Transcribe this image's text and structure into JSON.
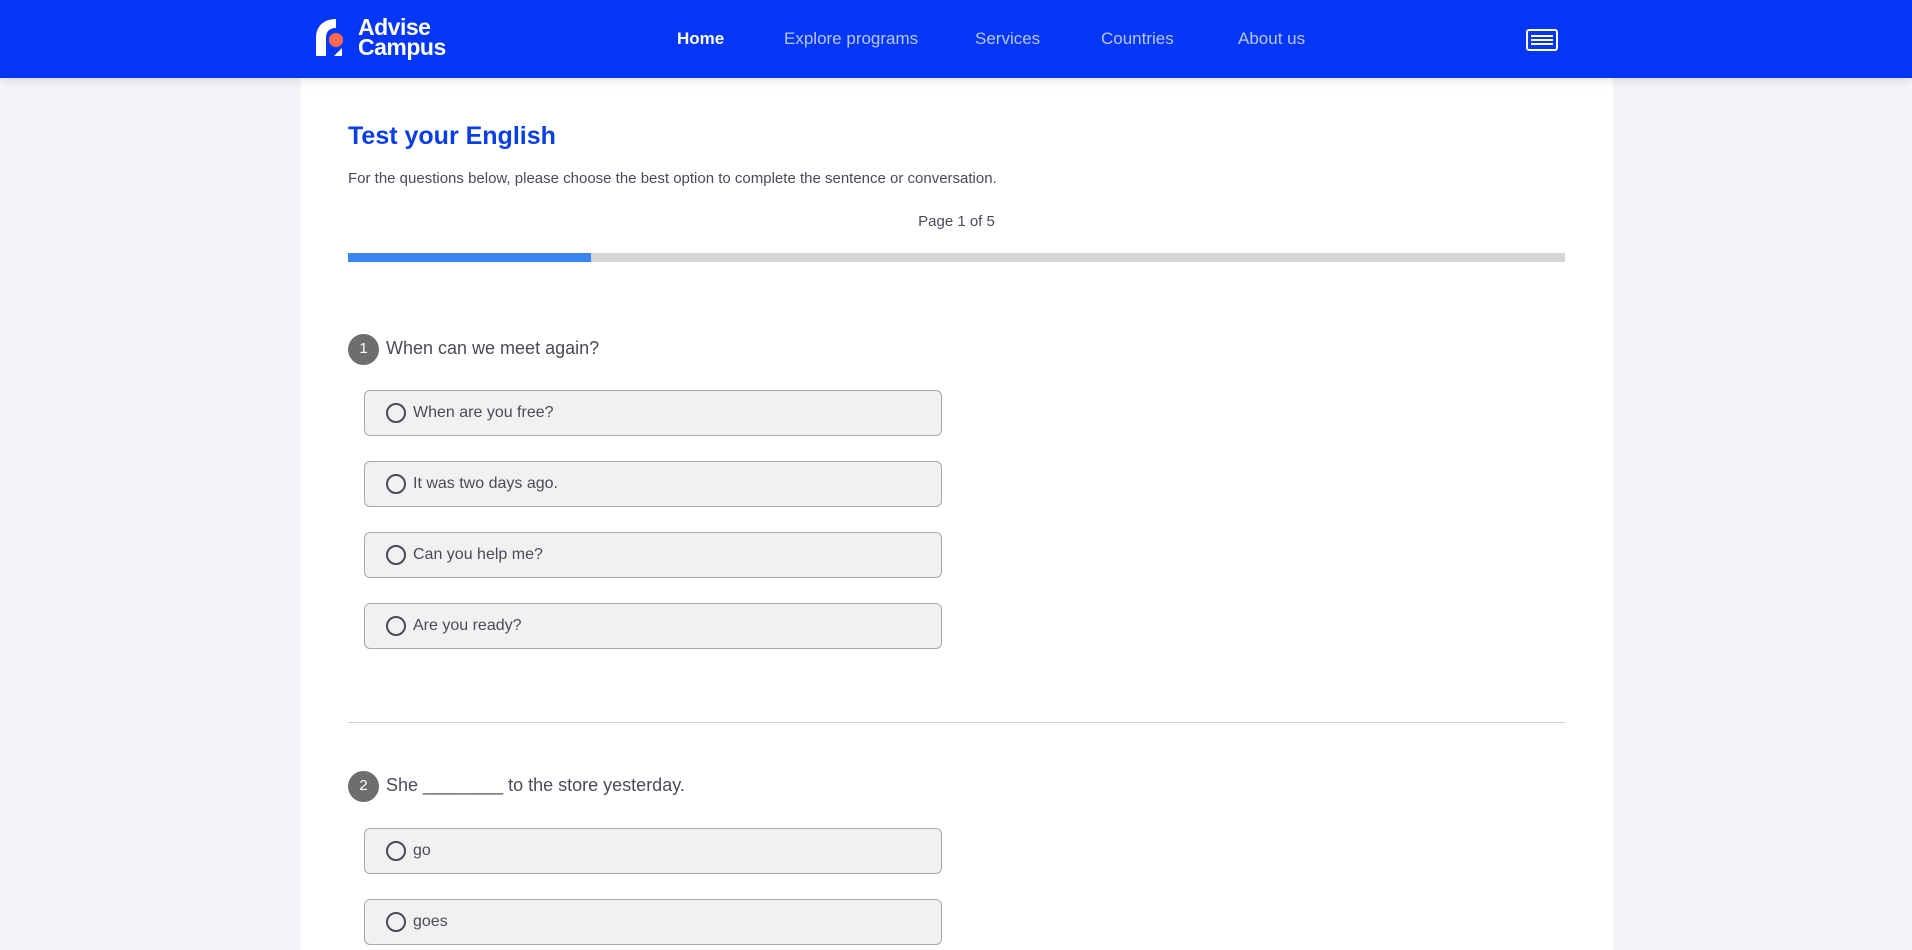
{
  "brand": {
    "line1": "Advise",
    "line2": "Campus",
    "colors": {
      "primary": "#0436f5",
      "accent": "#ff6b4a",
      "title": "#0a3ee6",
      "progress": "#3a86f0"
    }
  },
  "nav": {
    "items": [
      {
        "label": "Home",
        "active": true
      },
      {
        "label": "Explore programs",
        "active": false
      },
      {
        "label": "Services",
        "active": false
      },
      {
        "label": "Countries",
        "active": false
      },
      {
        "label": "About us",
        "active": false
      }
    ],
    "menu_icon": "hamburger-menu-icon"
  },
  "quiz": {
    "title": "Test your English",
    "instructions": "For the questions below, please choose the best option to complete the sentence or conversation.",
    "page_indicator": "Page 1 of 5",
    "progress_fraction": 0.2,
    "questions": [
      {
        "number": "1",
        "text": "When can we meet again?",
        "options": [
          "When are you free?",
          "It was two days ago.",
          "Can you help me?",
          "Are you ready?"
        ]
      },
      {
        "number": "2",
        "text": "She ________ to the store yesterday.",
        "options": [
          "go",
          "goes"
        ]
      }
    ]
  }
}
